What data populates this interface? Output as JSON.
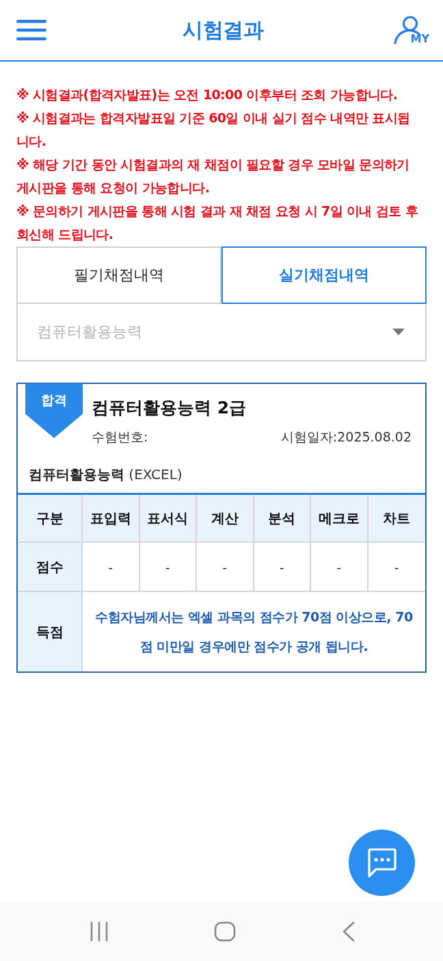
{
  "header": {
    "title": "시험결과",
    "my_label": "MY"
  },
  "notices": [
    "※ 시험결과(합격자발표)는 오전 10:00 이후부터 조회 가능합니다.",
    "※ 시험결과는 합격자발표일 기준 60일 이내 실기 점수 내역만 표시됩니다.",
    "※ 해당 기간 동안 시험결과의 재 채점이 필요할 경우 모바일 문의하기 게시판을 통해 요청이 가능합니다.",
    "※ 문의하기 게시판을 통해 시험 결과 재 채점 요청 시 7일 이내 검토 후 회신해 드립니다."
  ],
  "tabs": [
    {
      "label": "필기채점내역",
      "selected": false
    },
    {
      "label": "실기채점내역",
      "selected": true
    }
  ],
  "subject_select": {
    "placeholder": "컴퓨터활용능력"
  },
  "result": {
    "status": "합격",
    "title": "컴퓨터활용능력 2급",
    "exam_number_label": "수험번호:",
    "exam_date": "시험일자:2025.08.02",
    "subject": "**컴퓨터활용능력** (EXCEL)",
    "table": {
      "columns": [
        "구분",
        "표입력",
        "표서식",
        "계산",
        "분석",
        "메크로",
        "차트"
      ],
      "rows": [
        {
          "kind": "scores",
          "cells": [
            "점수",
            "-",
            "-",
            "-",
            "-",
            "-",
            "-"
          ]
        },
        {
          "kind": "note",
          "cells": [
            "득점",
            "수험자님께서는 엑셀 과목의 점수가 70점 이상으로, 70점 미만일 경우에만 점수가 공개 됩니다."
          ]
        }
      ]
    }
  }
}
